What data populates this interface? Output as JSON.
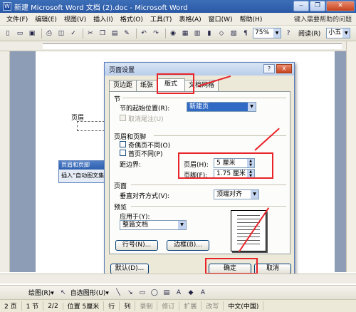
{
  "window": {
    "title": "新建 Microsoft Word 文档 (2).doc - Microsoft Word",
    "icon_letter": "W"
  },
  "menu": {
    "items": [
      "文件(F)",
      "编辑(E)",
      "视图(V)",
      "插入(I)",
      "格式(O)",
      "工具(T)",
      "表格(A)",
      "窗口(W)",
      "帮助(H)"
    ],
    "help_hint": "键入需要帮助的问题"
  },
  "toolbar": {
    "zoom": "75%",
    "read_label": "阅读(R)",
    "font_size": "小五"
  },
  "document": {
    "header_label": "页眉"
  },
  "hf_toolbar": {
    "title": "页眉和页脚",
    "insert_label": "插入“自动图文集”"
  },
  "dialog": {
    "title": "页面设置",
    "help": "?",
    "close": "X",
    "tabs": [
      "页边距",
      "纸张",
      "版式",
      "文档网格"
    ],
    "section": {
      "heading": "节",
      "start_label": "节的起始位置(R):",
      "start_value": "新建页",
      "endnote_label": "取消尾注(U)"
    },
    "header_footer": {
      "heading": "页眉和页脚",
      "odd_even_label": "奇偶页不同(O)",
      "first_page_label": "首页不同(P)",
      "distance_label": "距边界:",
      "header_label": "页眉(H):",
      "header_value": "5 厘米",
      "footer_label": "页脚(F):",
      "footer_value": "1.75 厘米"
    },
    "page": {
      "heading": "页面",
      "valign_label": "垂直对齐方式(V):",
      "valign_value": "顶端对齐"
    },
    "preview": {
      "heading": "预览",
      "apply_label": "应用于(Y):",
      "apply_value": "整篇文档"
    },
    "line_numbers_button": "行号(N)...",
    "borders_button": "边框(B)...",
    "default_button": "默认(D)...",
    "ok_button": "确定",
    "cancel_button": "取消"
  },
  "drawbar": {
    "draw_label": "绘图(R)▾",
    "autoshapes_label": "自选图形(U)▾"
  },
  "status": {
    "page": "2 页",
    "section": "1 节",
    "pages": "2/2",
    "position": "位置 5厘米",
    "line": "行",
    "column": "列",
    "rec": "录制",
    "trk": "修订",
    "ext": "扩展",
    "ovr": "改写",
    "lang": "中文(中国)"
  },
  "colors": {
    "annotation": "#e8232a",
    "title_blue": "#2a58a6",
    "dialog_bg": "#ece9d8"
  }
}
